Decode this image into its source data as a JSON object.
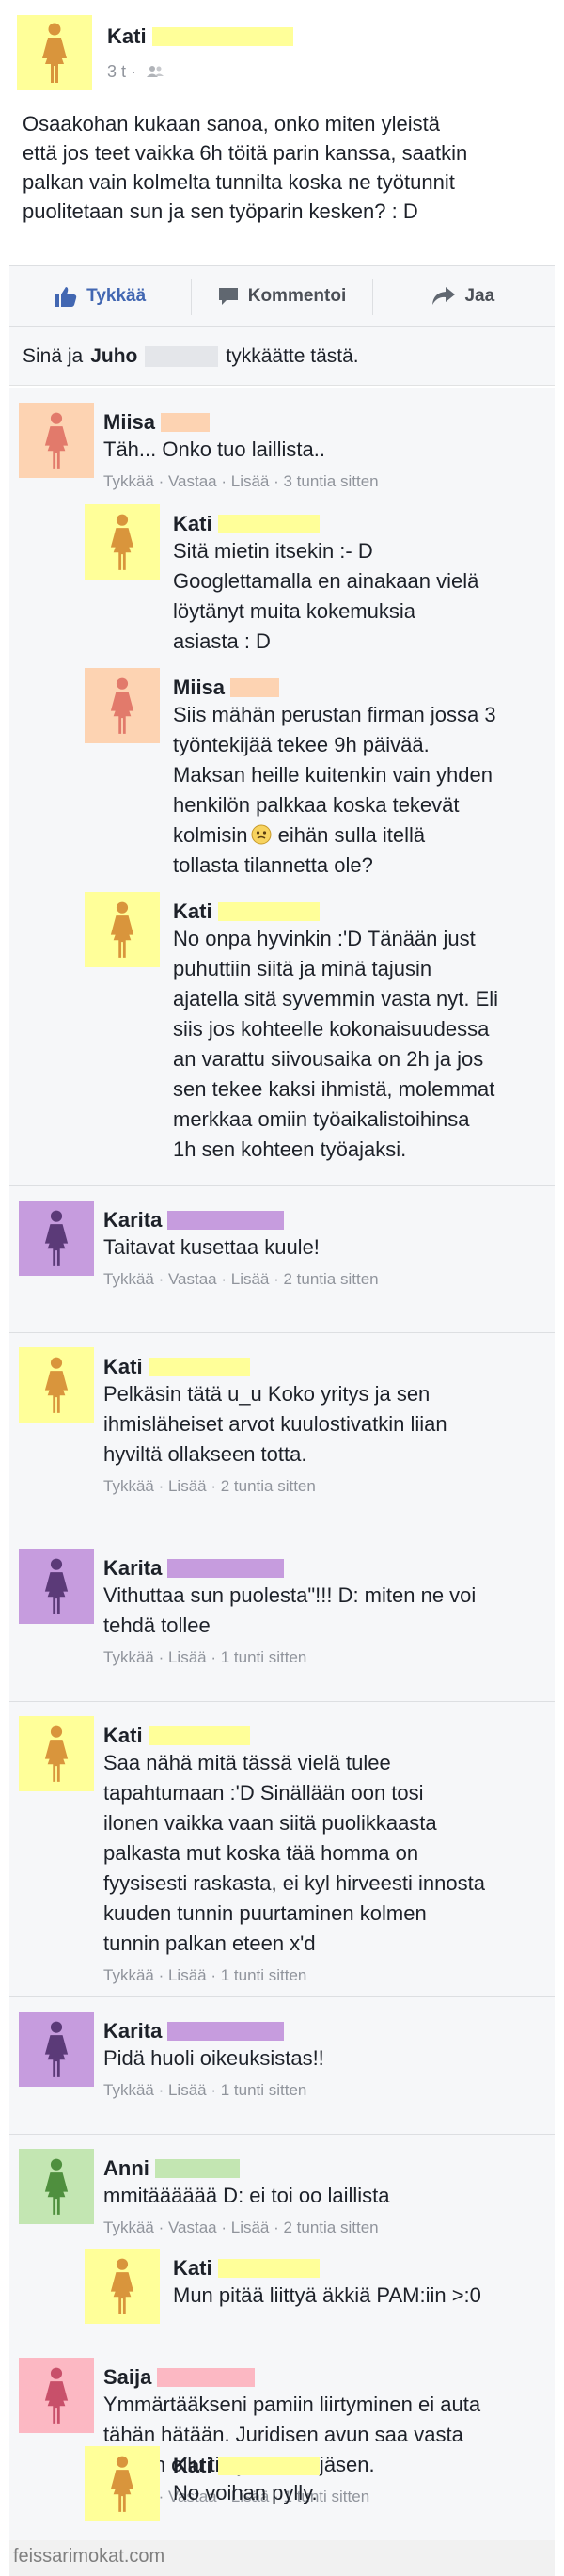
{
  "post": {
    "author": "Kati",
    "time": "3 t",
    "text": "Osaakohan kukaan sanoa, onko miten yleistä\nettä jos teet vaikka 6h töitä parin kanssa, saatkin\npalkan vain kolmelta tunnilta koska ne työtunnit\npuolitetaan sun ja sen työparin kesken? : D"
  },
  "actions": {
    "like": "Tykkää",
    "comment": "Kommentoi",
    "share": "Jaa"
  },
  "likes": {
    "prefix": "Sinä ja",
    "name": "Juho",
    "suffix": "tykkäätte tästä."
  },
  "colors": {
    "kati": "#ffff99",
    "kati_fig": "#d9953c",
    "miisa": "#fdd3b2",
    "miisa_fig": "#e27a6b",
    "karita": "#c69cde",
    "karita_fig": "#5b3a78",
    "anni": "#c3e6b2",
    "anni_fig": "#4f8f3e",
    "saija": "#fcb8c3",
    "saija_fig": "#c8506a",
    "like_blue": "#4267b2"
  },
  "comments": [
    {
      "name": "Miisa",
      "text": "Täh... Onko tuo laillista..",
      "meta": "Tykkää · Vastaa · Lisää · 3 tuntia sitten"
    },
    {
      "name": "Kati",
      "text": "Sitä mietin itsekin :- D\nGooglettamalla en ainakaan vielä\nlöytänyt muita kokemuksia\nasiasta : D"
    },
    {
      "name": "Miisa",
      "text": "Siis mähän perustan firman jossa 3\ntyöntekijää tekee 9h päivää.\nMaksan heille kuitenkin vain yhden\nhenkilön palkkaa koska tekevät\nkolmisin",
      "text_end": " eihän sulla itellä\ntollasta tilannetta ole?"
    },
    {
      "name": "Kati",
      "text": "No onpa hyvinkin :'D Tänään just\npuhuttiin siitä ja minä tajusin\najatella sitä syvemmin vasta nyt. Eli\nsiis jos kohteelle kokonaisuudessa\nan varattu siivousaika on 2h ja jos\nsen tekee kaksi ihmistä, molemmat\nmerkkaa omiin työaikalistoihinsa\n1h sen kohteen työajaksi."
    },
    {
      "name": "Karita",
      "text": "Taitavat kusettaa kuule!",
      "meta": "Tykkää · Vastaa · Lisää · 2 tuntia sitten"
    },
    {
      "name": "Kati",
      "text": "Pelkäsin tätä u_u Koko yritys ja sen\nihmisläheiset arvot kuulostivatkin liian\nhyviltä ollakseen totta.",
      "meta": "Tykkää · Lisää · 2 tuntia sitten"
    },
    {
      "name": "Karita",
      "text": "Vithuttaa sun puolesta\"!!! D: miten ne voi\ntehdä tollee",
      "meta": "Tykkää · Lisää · 1 tunti sitten"
    },
    {
      "name": "Kati",
      "text": "Saa nähä mitä tässä vielä tulee\ntapahtumaan :'D Sinällään oon tosi\nilonen vaikka vaan siitä puolikkaasta\npalkasta mut koska tää homma on\nfyysisesti raskasta, ei kyl hirveesti innosta\nkuuden tunnin puurtaminen kolmen\ntunnin palkan eteen x'd",
      "meta": "Tykkää · Lisää · 1 tunti sitten"
    },
    {
      "name": "Karita",
      "text": "Pidä huoli oikeuksistas!!",
      "meta": "Tykkää · Lisää · 1 tunti sitten"
    },
    {
      "name": "Anni",
      "text": "mmitääääää D: ei toi oo laillista",
      "meta": "Tykkää · Vastaa · Lisää · 2 tuntia sitten"
    },
    {
      "name": "Kati",
      "text": "Mun pitää liittyä äkkiä PAM:iin >:0"
    },
    {
      "name": "Saija",
      "text": "Ymmärtääkseni pamiin liirtyminen ei auta\ntähän hätään. Juridisen avun saa vasta\nkun on ollu tietyn aikaa jäsen.",
      "meta": "Tykkää · Vastaa · Lisää · 1 tunti sitten"
    },
    {
      "name": "Kati",
      "text": "No voihan pylly."
    }
  ],
  "watermark": "feissarimokat.com"
}
